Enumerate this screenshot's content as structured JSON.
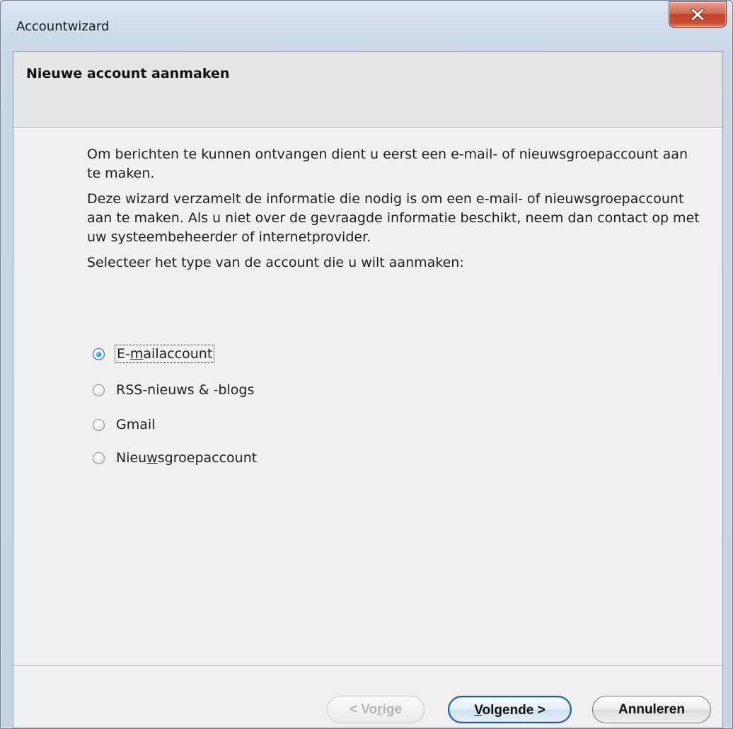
{
  "window": {
    "title": "Accountwizard",
    "close_icon": "close-icon"
  },
  "header": {
    "title": "Nieuwe account aanmaken"
  },
  "content": {
    "paragraph_1": "Om berichten te kunnen ontvangen dient u eerst een e-mail- of nieuwsgroepaccount aan te maken.",
    "paragraph_2": "Deze wizard verzamelt de informatie die nodig is om een e-mail- of nieuwsgroepaccount aan te maken. Als u niet over de gevraagde informatie beschikt, neem dan contact op met uw systeembeheerder of internetprovider.",
    "paragraph_3": "Selecteer het type van de account die u wilt aanmaken:"
  },
  "account_types": {
    "selected": "E-mailaccount",
    "options": [
      {
        "pre": "E-",
        "accel": "m",
        "post": "ailaccount",
        "checked": true
      },
      {
        "pre": "RSS-nieuws & -blogs",
        "accel": "",
        "post": "",
        "checked": false
      },
      {
        "pre": "Gmail",
        "accel": "",
        "post": "",
        "checked": false
      },
      {
        "pre": "Nieu",
        "accel": "w",
        "post": "sgroepaccount",
        "checked": false
      }
    ]
  },
  "buttons": {
    "back": {
      "pre": "< Vo",
      "accel": "r",
      "post": "ige",
      "enabled": false
    },
    "next": {
      "pre": "",
      "accel": "V",
      "post": "olgende >",
      "enabled": true
    },
    "cancel": {
      "label": "Annuleren",
      "enabled": true
    }
  },
  "colors": {
    "accent": "#1f5f9c",
    "close_button": "#c8492f"
  }
}
